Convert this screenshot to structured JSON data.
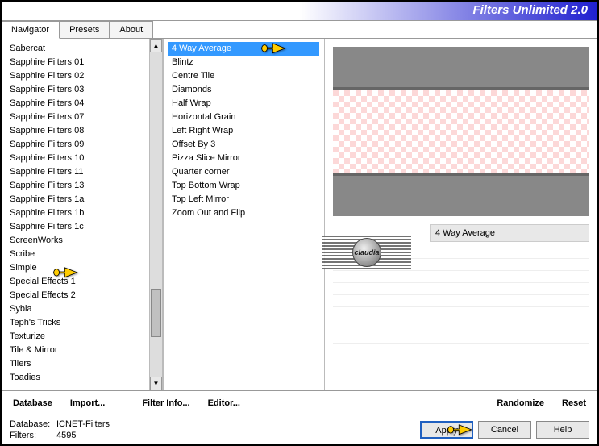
{
  "app_title": "Filters Unlimited 2.0",
  "tabs": [
    {
      "label": "Navigator",
      "active": true
    },
    {
      "label": "Presets",
      "active": false
    },
    {
      "label": "About",
      "active": false
    }
  ],
  "left_list": [
    "Sabercat",
    "Sapphire Filters 01",
    "Sapphire Filters 02",
    "Sapphire Filters 03",
    "Sapphire Filters 04",
    "Sapphire Filters 07",
    "Sapphire Filters 08",
    "Sapphire Filters 09",
    "Sapphire Filters 10",
    "Sapphire Filters 11",
    "Sapphire Filters 13",
    "Sapphire Filters 1a",
    "Sapphire Filters 1b",
    "Sapphire Filters 1c",
    "ScreenWorks",
    "Scribe",
    "Simple",
    "Special Effects 1",
    "Special Effects 2",
    "Sybia",
    "Teph's Tricks",
    "Texturize",
    "Tile & Mirror",
    "Tilers",
    "Toadies"
  ],
  "left_selected": "Simple",
  "mid_list": [
    "4 Way Average",
    "Blintz",
    "Centre Tile",
    "Diamonds",
    "Half Wrap",
    "Horizontal Grain",
    "Left Right Wrap",
    "Offset By 3",
    "Pizza Slice Mirror",
    "Quarter corner",
    "Top Bottom Wrap",
    "Top Left Mirror",
    "Zoom Out and Flip"
  ],
  "mid_selected": "4 Way Average",
  "filter_name": "4 Way Average",
  "button_bar": {
    "database": "Database",
    "import": "Import...",
    "filter_info": "Filter Info...",
    "editor": "Editor...",
    "randomize": "Randomize",
    "reset": "Reset"
  },
  "status": {
    "db_label": "Database:",
    "db_value": "ICNET-Filters",
    "filters_label": "Filters:",
    "filters_value": "4595"
  },
  "dialog_buttons": {
    "apply": "Apply",
    "cancel": "Cancel",
    "help": "Help"
  },
  "watermark_text": "claudia"
}
